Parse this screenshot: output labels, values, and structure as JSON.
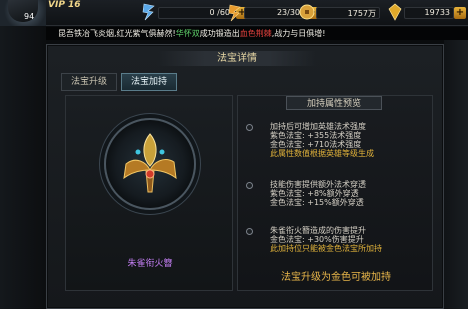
{
  "player": {
    "vip": "VIP 16",
    "level": "94"
  },
  "resources": [
    {
      "icon": "energy-icon",
      "value": "0 /60"
    },
    {
      "icon": "stamina-icon",
      "value": "23/30"
    },
    {
      "icon": "coin-icon",
      "value": "1757万"
    },
    {
      "icon": "gem-icon",
      "value": "19733"
    }
  ],
  "marquee": {
    "part1": "昆吾铁冶飞炎烟,红光紫气俱赫然!",
    "player_name": "华怀双",
    "part2": "成功锻造出",
    "item": "血色荆棘",
    "part3": ",战力与日俱增!"
  },
  "panel": {
    "title": "法宝详情",
    "tabs": [
      {
        "label": "法宝升级",
        "active": false
      },
      {
        "label": "法宝加持",
        "active": true
      }
    ],
    "treasure_name": "朱雀衔火簪",
    "section_title": "加持属性预览",
    "items": [
      {
        "lines": [
          "加持后可增加英雄法术强度",
          "紫色法宝: +355法术强度",
          "金色法宝: +710法术强度",
          "此属性数值根据英雄等级生成"
        ]
      },
      {
        "lines": [
          "技能伤害提供额外法术穿透",
          "紫色法宝: +8%额外穿透",
          "金色法宝: +15%额外穿透"
        ]
      },
      {
        "lines": [
          "朱雀衔火簪造成的伤害提升",
          "金色法宝: +30%伤害提升",
          "此加持位只能被金色法宝所加持"
        ]
      }
    ],
    "footer": "法宝升级为金色可被加持"
  },
  "colors": {
    "purple_name": "#c37ef2",
    "gold_text": "#e0b23a",
    "accent_orange": "#e8b64a"
  }
}
